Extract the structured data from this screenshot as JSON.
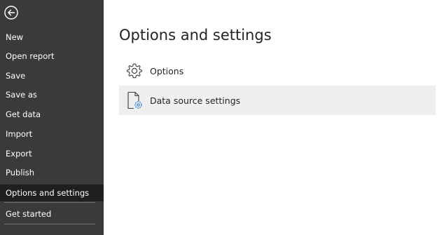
{
  "sidebar": {
    "back_icon": "back-arrow-icon",
    "items": [
      {
        "label": "New"
      },
      {
        "label": "Open report"
      },
      {
        "label": "Save"
      },
      {
        "label": "Save as"
      },
      {
        "label": "Get data"
      },
      {
        "label": "Import"
      },
      {
        "label": "Export"
      },
      {
        "label": "Publish"
      },
      {
        "label": "Options and settings",
        "selected": true
      },
      {
        "label": "Get started"
      }
    ]
  },
  "main": {
    "title": "Options and settings",
    "options": [
      {
        "label": "Options",
        "icon": "gear-icon"
      },
      {
        "label": "Data source settings",
        "icon": "data-source-settings-icon"
      }
    ]
  },
  "colors": {
    "sidebar_bg": "#3b3a39",
    "selected_bg": "#201f1e",
    "hover_bg": "#f0efee",
    "accent": "#2b7cd3"
  }
}
